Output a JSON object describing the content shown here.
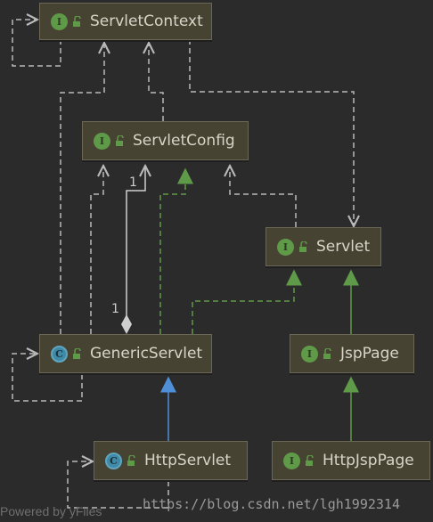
{
  "nodes": {
    "servlet_context": {
      "label": "ServletContext",
      "kind": "interface"
    },
    "servlet_config": {
      "label": "ServletConfig",
      "kind": "interface"
    },
    "servlet": {
      "label": "Servlet",
      "kind": "interface"
    },
    "generic_servlet": {
      "label": "GenericServlet",
      "kind": "class"
    },
    "jsp_page": {
      "label": "JspPage",
      "kind": "interface"
    },
    "http_servlet": {
      "label": "HttpServlet",
      "kind": "class"
    },
    "http_jsp_page": {
      "label": "HttpJspPage",
      "kind": "interface"
    }
  },
  "badges": {
    "interface": "I",
    "class": "C"
  },
  "multiplicity": {
    "top": "1",
    "bottom": "1"
  },
  "colors": {
    "background": "#2b2b2b",
    "node_fill": "#474333",
    "dependency": "#b9b9b9",
    "implements": "#5f9a48",
    "extends_class": "#4f8fd8",
    "extends_interface": "#5f9a48"
  },
  "watermark": "https://blog.csdn.net/lgh1992314",
  "footer": "Powered by yFiles"
}
